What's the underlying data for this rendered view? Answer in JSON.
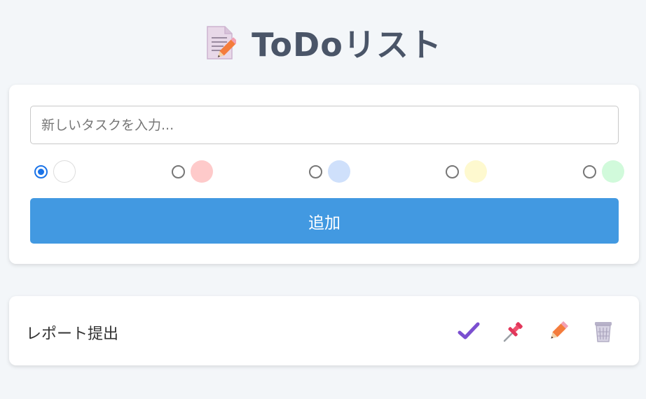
{
  "header": {
    "title": "ToDoリスト",
    "icon": "memo-icon"
  },
  "add_form": {
    "input": {
      "value": "",
      "placeholder": "新しいタスクを入力..."
    },
    "colors": [
      {
        "hex": "#ffffff",
        "selected": true
      },
      {
        "hex": "#fecaca",
        "selected": false
      },
      {
        "hex": "#cfe0fb",
        "selected": false
      },
      {
        "hex": "#fef9cf",
        "selected": false
      },
      {
        "hex": "#d1fadb",
        "selected": false
      }
    ],
    "add_label": "追加"
  },
  "tasks": [
    {
      "text": "レポート提出",
      "actions": [
        "check-icon",
        "pin-icon",
        "pencil-icon",
        "trash-icon"
      ]
    }
  ],
  "theme": {
    "background": "#f3f6f9",
    "accent": "#4299e1",
    "title_color": "#4a5568"
  }
}
